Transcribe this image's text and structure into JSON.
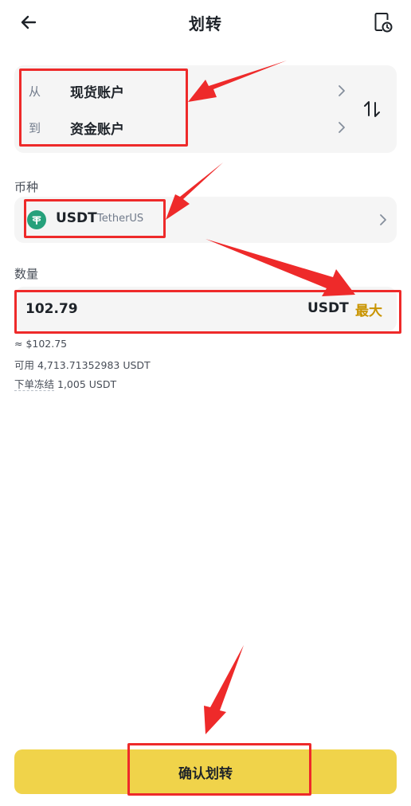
{
  "header": {
    "title": "划转",
    "back_icon": "arrow-left-icon",
    "history_icon": "order-history-icon"
  },
  "transfer": {
    "from_prefix": "从",
    "from_account": "现货账户",
    "to_prefix": "到",
    "to_account": "资金账户",
    "swap_icon": "swap-vertical-icon"
  },
  "coin": {
    "label": "币种",
    "symbol": "USDT",
    "name": "TetherUS",
    "logo_color": "#26a17b"
  },
  "amount": {
    "label": "数量",
    "value": "102.79",
    "unit": "USDT",
    "max_label": "最大",
    "approx_value": "≈ $102.75",
    "available_text": "可用 4,713.71352983 USDT",
    "frozen_label": "下单冻结",
    "frozen_value": " 1,005 USDT"
  },
  "confirm_button": {
    "label": "确认划转"
  },
  "colors": {
    "accent": "#c99400",
    "button_yellow": "#f0d34a",
    "annotation_red": "#ee2a2a"
  }
}
